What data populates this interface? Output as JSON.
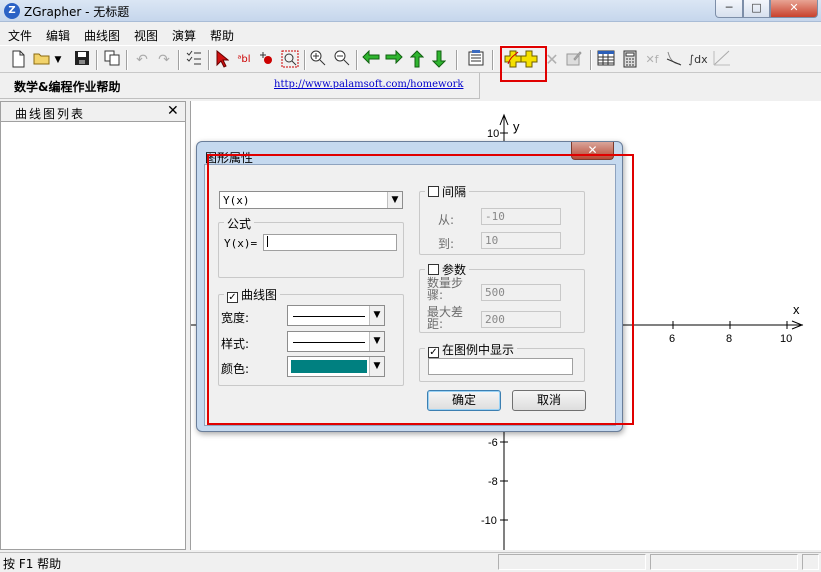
{
  "window": {
    "app_icon_letter": "Z",
    "title": "ZGrapher - 无标题",
    "minimize_glyph": "─",
    "maximize_glyph": "□",
    "close_glyph": "✕"
  },
  "menu": [
    "文件",
    "编辑",
    "曲线图",
    "视图",
    "演算",
    "帮助"
  ],
  "toolbar": {
    "icons": [
      "new-file-icon",
      "open-folder-icon",
      "dropdown-arrow-icon",
      "save-icon",
      "copy-icon",
      "undo-icon",
      "redo-icon",
      "list-icon",
      "pointer-icon",
      "label-icon",
      "point-icon",
      "zoom-box-icon",
      "zoom-in-icon",
      "zoom-out-icon",
      "pan-left-icon",
      "pan-right-icon",
      "pan-up-icon",
      "pan-down-icon",
      "properties-icon",
      "add-curve-icon",
      "add-function-icon",
      "delete-icon",
      "edit-icon",
      "table-icon",
      "calculator-icon",
      "derivative-icon",
      "tangent-icon",
      "integral-icon",
      "ruler-icon"
    ]
  },
  "homework": {
    "title": "数学&编程作业帮助",
    "link": "http://www.palamsoft.com/homework"
  },
  "curve_panel": {
    "title": "曲线图列表",
    "close_glyph": "✕"
  },
  "graph": {
    "x_axis_label": "x",
    "y_axis_label": "y",
    "x_tick_labels": [
      "6",
      "8",
      "10"
    ],
    "y_tick_labels": [
      "10",
      "-6",
      "-8",
      "-10"
    ]
  },
  "dialog": {
    "title": "图形属性",
    "close_glyph": "✕",
    "type_select": "Y(x)",
    "formula_group": "公式",
    "formula_label": "Y(x)=",
    "formula_value": "",
    "curve_group": "曲线图",
    "curve_checked": true,
    "width_label": "宽度:",
    "style_label": "样式:",
    "color_label": "颜色:",
    "color_value": "#008080",
    "interval_group": "间隔",
    "interval_checked": false,
    "from_label": "从:",
    "from_value": "-10",
    "to_label": "到:",
    "to_value": "10",
    "params_group": "参数",
    "params_checked": false,
    "steps_label": "数量步骤:",
    "steps_value": "500",
    "max_diff_label": "最大差距:",
    "max_diff_value": "200",
    "legend_group": "在图例中显示",
    "legend_checked": true,
    "legend_value": "",
    "ok": "确定",
    "cancel": "取消"
  },
  "status": {
    "text": "按 F1 帮助"
  },
  "colors": {
    "highlight": "#e00000",
    "curve_color": "#008080"
  }
}
